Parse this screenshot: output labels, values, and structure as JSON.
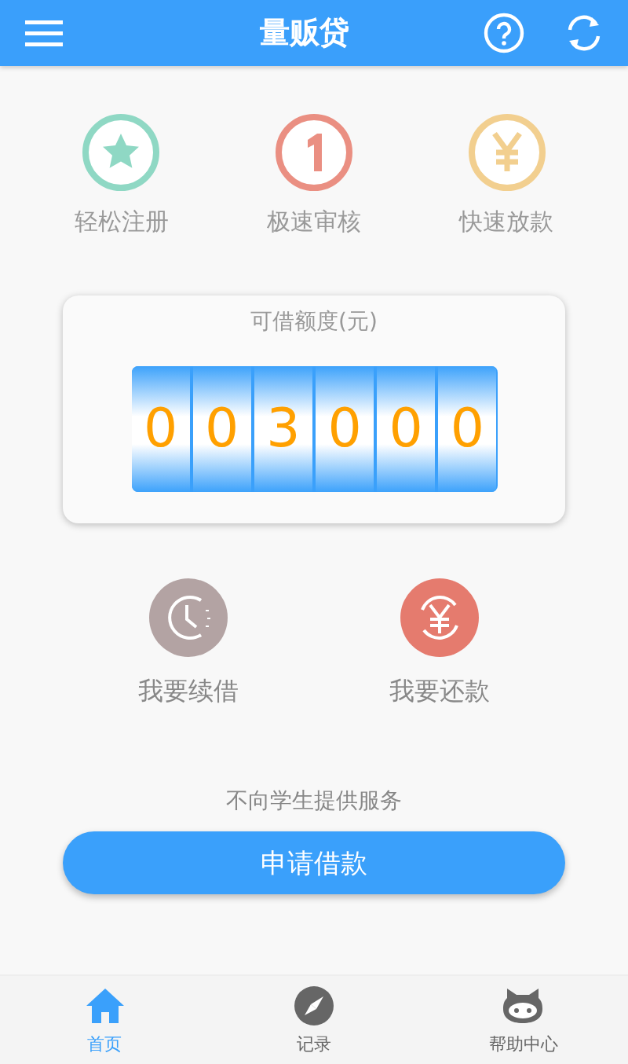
{
  "header": {
    "title": "量贩贷"
  },
  "steps": [
    {
      "label": "轻松注册",
      "kind": "star",
      "color": "#8fd8c4"
    },
    {
      "label": "极速审核",
      "kind": "one",
      "color": "#ea8f82"
    },
    {
      "label": "快速放款",
      "kind": "yen",
      "color": "#f2cf8f"
    }
  ],
  "credit": {
    "title": "可借额度(元)",
    "digits": [
      "0",
      "0",
      "3",
      "0",
      "0",
      "0"
    ]
  },
  "actions": [
    {
      "label": "我要续借",
      "kind": "clock",
      "color": "#b3a3a3"
    },
    {
      "label": "我要还款",
      "kind": "yen-cycle",
      "color": "#e57b6e"
    }
  ],
  "notice": "不向学生提供服务",
  "apply_button": "申请借款",
  "tabs": [
    {
      "label": "首页",
      "kind": "home",
      "selected": true
    },
    {
      "label": "记录",
      "kind": "compass",
      "selected": false
    },
    {
      "label": "帮助中心",
      "kind": "cat",
      "selected": false
    }
  ]
}
